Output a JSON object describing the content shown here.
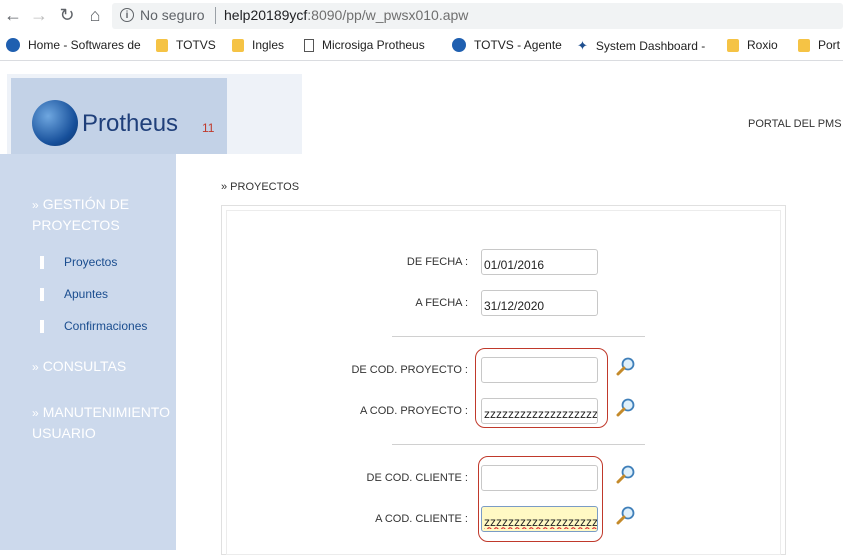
{
  "browser": {
    "security_text": "No seguro",
    "url_host": "help20189ycf",
    "url_rest": ":8090/pp/w_pwsx010.apw",
    "icons": [
      "back-icon",
      "forward-icon",
      "reload-icon",
      "home-icon",
      "info-icon"
    ]
  },
  "bookmarks": [
    {
      "label": "Home - Softwares de",
      "icon": "globe-icon"
    },
    {
      "label": "TOTVS",
      "icon": "folder-icon"
    },
    {
      "label": "Ingles",
      "icon": "folder-icon"
    },
    {
      "label": "Microsiga Protheus",
      "icon": "page-icon"
    },
    {
      "label": "TOTVS - Agente",
      "icon": "globe-icon"
    },
    {
      "label": "System Dashboard -",
      "icon": "bug-icon"
    },
    {
      "label": "Roxio",
      "icon": "folder-icon"
    },
    {
      "label": "Port",
      "icon": "folder-icon"
    }
  ],
  "header": {
    "logo_text": "Protheus",
    "logo_version": "11",
    "portal_label": "PORTAL DEL PMS"
  },
  "sidebar": {
    "section1": "GESTIÓN DE PROYECTOS",
    "items": [
      "Proyectos",
      "Apuntes",
      "Confirmaciones"
    ],
    "section2": "CONSULTAS",
    "section3": "MANUTENIMIENTO USUARIO",
    "bullet": "»"
  },
  "breadcrumb": "» PROYECTOS",
  "form": {
    "de_fecha_label": "DE FECHA :",
    "de_fecha_value": "01/01/2016",
    "a_fecha_label": "A FECHA :",
    "a_fecha_value": "31/12/2020",
    "de_proyecto_label": "DE COD. PROYECTO :",
    "de_proyecto_value": "",
    "a_proyecto_label": "A COD. PROYECTO :",
    "a_proyecto_value": "zzzzzzzzzzzzzzzzzzzz",
    "de_cliente_label": "DE COD. CLIENTE :",
    "de_cliente_value": "",
    "a_cliente_label": "A COD. CLIENTE :",
    "a_cliente_value": "zzzzzzzzzzzzzzzzzzzz"
  },
  "colors": {
    "sidebar_bg": "#ccd9ec",
    "highlight_border": "#c0392b",
    "link": "#1a4d8f"
  }
}
